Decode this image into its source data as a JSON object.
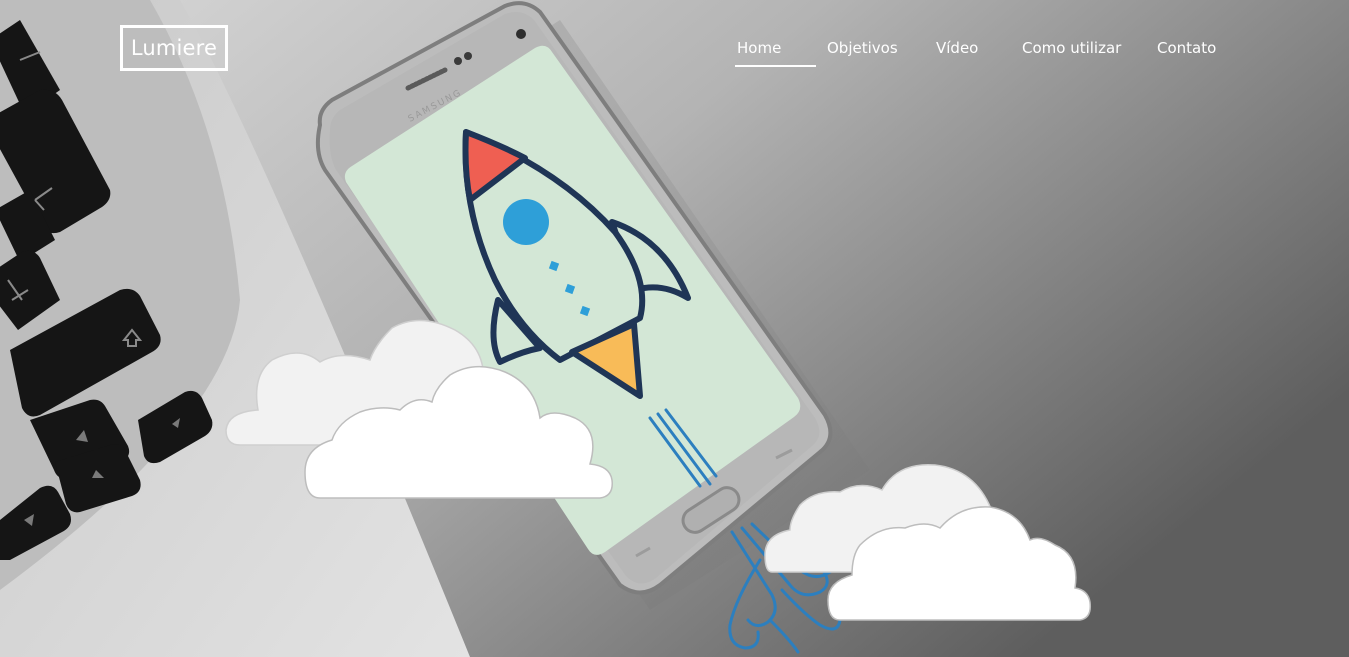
{
  "brand": {
    "logo_text": "Lumiere"
  },
  "nav": {
    "items": [
      {
        "label": "Home",
        "active": true
      },
      {
        "label": "Objetivos",
        "active": false
      },
      {
        "label": "Vídeo",
        "active": false
      },
      {
        "label": "Como utilizar",
        "active": false
      },
      {
        "label": "Contato",
        "active": false
      }
    ]
  },
  "hero": {
    "icon": "rocket-icon",
    "colors": {
      "screen": "#d3e7d6",
      "rocket_outline": "#1f3556",
      "rocket_nose": "#ef5f52",
      "rocket_window": "#2e9fd8",
      "rocket_flame": "#f8bb58",
      "exhaust": "#2c7fbf"
    }
  }
}
